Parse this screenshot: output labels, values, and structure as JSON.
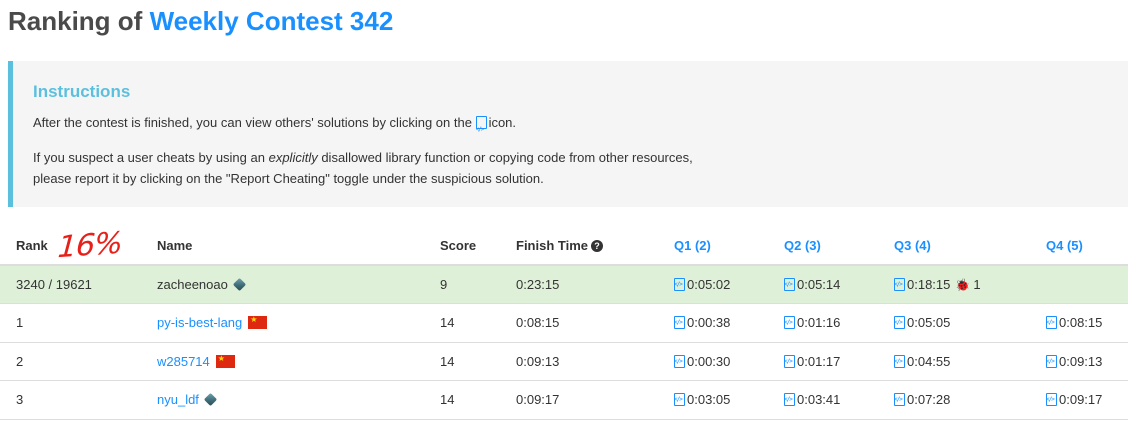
{
  "title": {
    "prefix": "Ranking of ",
    "contest": "Weekly Contest 342"
  },
  "instructions": {
    "heading": "Instructions",
    "line1_before": "After the contest is finished, you can view others' solutions by clicking on the",
    "line1_after": "icon.",
    "line2_before": "If you suspect a user cheats by using an ",
    "line2_em": "explicitly",
    "line2_after": " disallowed library function or copying code from other resources,",
    "line3": "please report it by clicking on the \"Report Cheating\" toggle under the suspicious solution."
  },
  "annotation": "16%",
  "columns": {
    "rank": "Rank",
    "name": "Name",
    "score": "Score",
    "finish": "Finish Time",
    "q1": "Q1 (2)",
    "q2": "Q2 (3)",
    "q3": "Q3 (4)",
    "q4": "Q4 (5)"
  },
  "rows": [
    {
      "rank": "3240 / 19621",
      "name": "zacheenoao",
      "badge": "cube-icon",
      "score": "9",
      "finish": "0:23:15",
      "q1": "0:05:02",
      "q2": "0:05:14",
      "q3": "0:18:15",
      "q3_bugs": "1",
      "q4": ""
    },
    {
      "rank": "1",
      "name": "py-is-best-lang",
      "badge": "china-flag-icon",
      "score": "14",
      "finish": "0:08:15",
      "q1": "0:00:38",
      "q2": "0:01:16",
      "q3": "0:05:05",
      "q3_bugs": "",
      "q4": "0:08:15"
    },
    {
      "rank": "2",
      "name": "w285714",
      "badge": "china-flag-icon",
      "score": "14",
      "finish": "0:09:13",
      "q1": "0:00:30",
      "q2": "0:01:17",
      "q3": "0:04:55",
      "q3_bugs": "",
      "q4": "0:09:13"
    },
    {
      "rank": "3",
      "name": "nyu_ldf",
      "badge": "cube-icon",
      "score": "14",
      "finish": "0:09:17",
      "q1": "0:03:05",
      "q2": "0:03:41",
      "q3": "0:07:28",
      "q3_bugs": "",
      "q4": "0:09:17"
    }
  ],
  "colors": {
    "accent": "#1a90ff",
    "info": "#5bc0de",
    "highlight_row": "#dff0d8",
    "annotation": "#e8201a"
  }
}
